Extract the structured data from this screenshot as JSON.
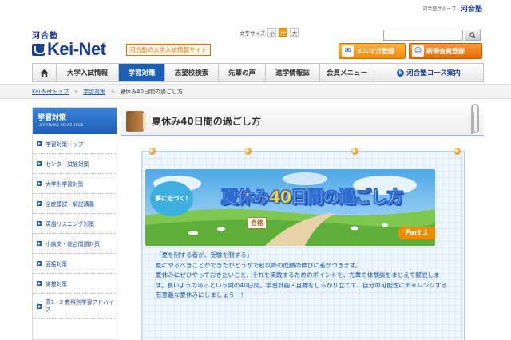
{
  "header": {
    "group_label": "河合塾グループ",
    "group_logo": "河合塾",
    "fontsize_label": "文字サイズ",
    "fontsize_options": [
      "小",
      "中",
      "大"
    ],
    "fontsize_selected": "中",
    "logo_top": "河合塾",
    "logo_main": "Kei-Net",
    "tagline": "河合塾の大学入試情報サイト",
    "search_placeholder": "",
    "mailmag_label": "メルマガ登録",
    "register_label": "新規会員登録"
  },
  "nav": {
    "items": [
      "大学入試情報",
      "学習対策",
      "志望校検索",
      "先輩の声",
      "進学情報誌",
      "会員メニュー",
      "河合塾コース案内"
    ],
    "active": "学習対策"
  },
  "breadcrumb": {
    "items": [
      "Kei-Netトップ",
      "学習対策",
      "夏休み40日間の過ごし方"
    ]
  },
  "sidebar": {
    "title": "学習対策",
    "subtitle": "LEARNING MEASURES",
    "items": [
      "学習対策トップ",
      "センター試験対策",
      "大学別学習対策",
      "全統模試・解説講義",
      "英語リスニング対策",
      "小論文・総合問題対策",
      "面接対策",
      "実技対策",
      "高1・2 教科別学習アドバイス"
    ]
  },
  "main": {
    "page_title": "夏休み40日間の過ごし方",
    "banner": {
      "bubble": "夢に近づく!",
      "title_pre": "夏休み",
      "title_num": "40",
      "title_post": "日間の過ごし方",
      "sign": "合格",
      "part": "Part 1"
    },
    "intro_lines": [
      "「夏を制する者が、受験を制する」",
      "夏にやるべきことができたかどうかで秋以降の成績の伸びに差がつきます。",
      "夏休みにぜひやっておきたいこと、それを実践するためのポイントを、先輩の体験談をまじえて解説しま",
      "す。長いようであっという間の40日間。学習計画・目標をしっかり立てて、自分の可能性にチャレンジする",
      "有意義な夏休みにしましょう！！"
    ]
  },
  "colors": {
    "brand_blue": "#1a3d9a",
    "nav_active": "#1a5fb4",
    "accent_orange": "#f28b00"
  }
}
